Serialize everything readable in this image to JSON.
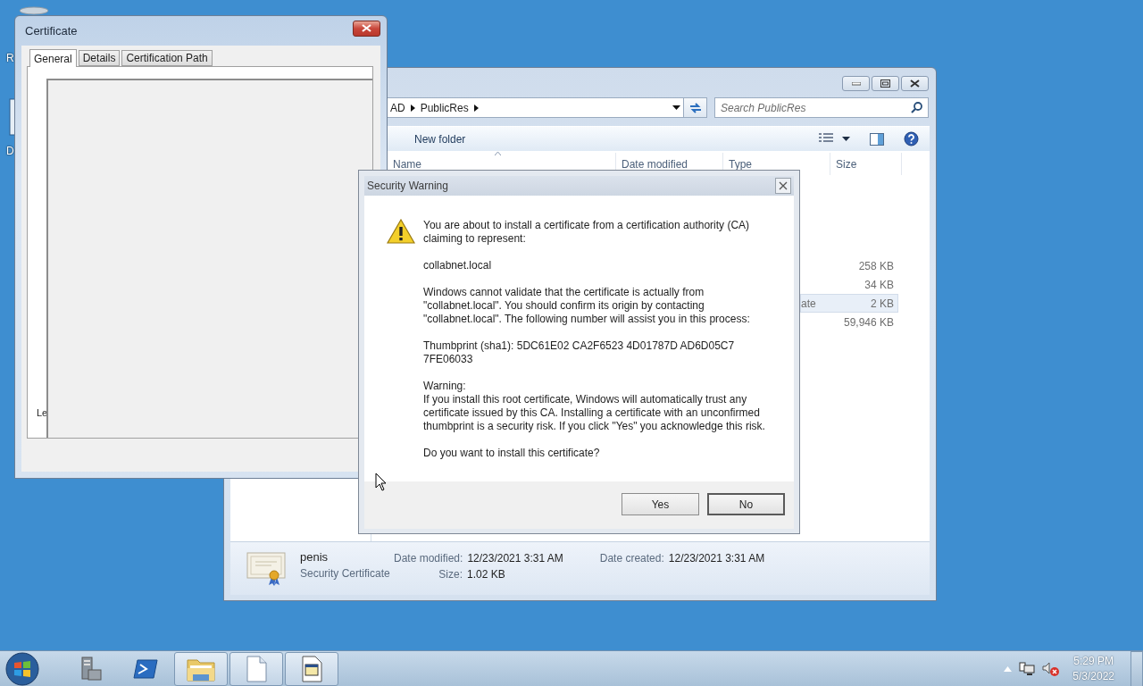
{
  "desktop": {
    "icons": [
      {
        "label": "R"
      },
      {
        "label": "D"
      }
    ]
  },
  "certificate_window": {
    "title": "Certificate",
    "tabs": [
      {
        "label": "General",
        "selected": true
      },
      {
        "label": "Details",
        "selected": false
      },
      {
        "label": "Certification Path",
        "selected": false
      }
    ],
    "panel_label": "Le"
  },
  "explorer_window": {
    "breadcrumb": [
      "AD",
      "PublicRes"
    ],
    "search": {
      "placeholder": "Search PublicRes"
    },
    "toolbar": {
      "new_folder": "New folder"
    },
    "columns": [
      "Name",
      "Date modified",
      "Type",
      "Size"
    ],
    "rows": [
      {
        "size": "258 KB",
        "selected": false
      },
      {
        "size": "34 KB",
        "selected": false
      },
      {
        "type": "ate",
        "size": "2 KB",
        "selected": true
      },
      {
        "size": "59,946 KB",
        "selected": false
      }
    ],
    "details": {
      "name": "penis",
      "type": "Security Certificate",
      "properties": [
        {
          "label": "Date modified:",
          "value": "12/23/2021 3:31 AM"
        },
        {
          "label": "Size:",
          "value": "1.02 KB"
        },
        {
          "label": "Date created:",
          "value": "12/23/2021 3:31 AM"
        }
      ]
    }
  },
  "security_dialog": {
    "title": "Security Warning",
    "paragraphs": [
      {
        "kind": "para",
        "text": "You are about to install a certificate from a certification authority (CA) claiming to represent:"
      },
      {
        "kind": "para",
        "text": "collabnet.local"
      },
      {
        "kind": "para",
        "text": "Windows cannot validate that the certificate is actually from \"collabnet.local\". You should confirm its origin by contacting \"collabnet.local\". The following number will assist you in this process:"
      },
      {
        "kind": "para",
        "text": "Thumbprint (sha1): 5DC61E02 CA2F6523 4D01787D AD6D05C7 7FE06033"
      },
      {
        "kind": "label",
        "text": "Warning:"
      },
      {
        "kind": "para",
        "text": "If you install this root certificate, Windows will automatically trust any certificate issued by this CA. Installing a certificate with an unconfirmed thumbprint is a security risk. If you click \"Yes\" you acknowledge this risk."
      },
      {
        "kind": "para",
        "text": "Do you want to install this certificate?"
      }
    ],
    "buttons": [
      {
        "label": "Yes",
        "default": false
      },
      {
        "label": "No",
        "default": true
      }
    ]
  },
  "taskbar": {
    "items": [
      {
        "kind": "server",
        "running": false
      },
      {
        "kind": "shell",
        "running": false
      },
      {
        "kind": "folder",
        "running": true
      },
      {
        "kind": "page",
        "running": true
      },
      {
        "kind": "window",
        "running": true
      }
    ],
    "clock": {
      "time": "5:29 PM",
      "date": "5/3/2022"
    }
  }
}
